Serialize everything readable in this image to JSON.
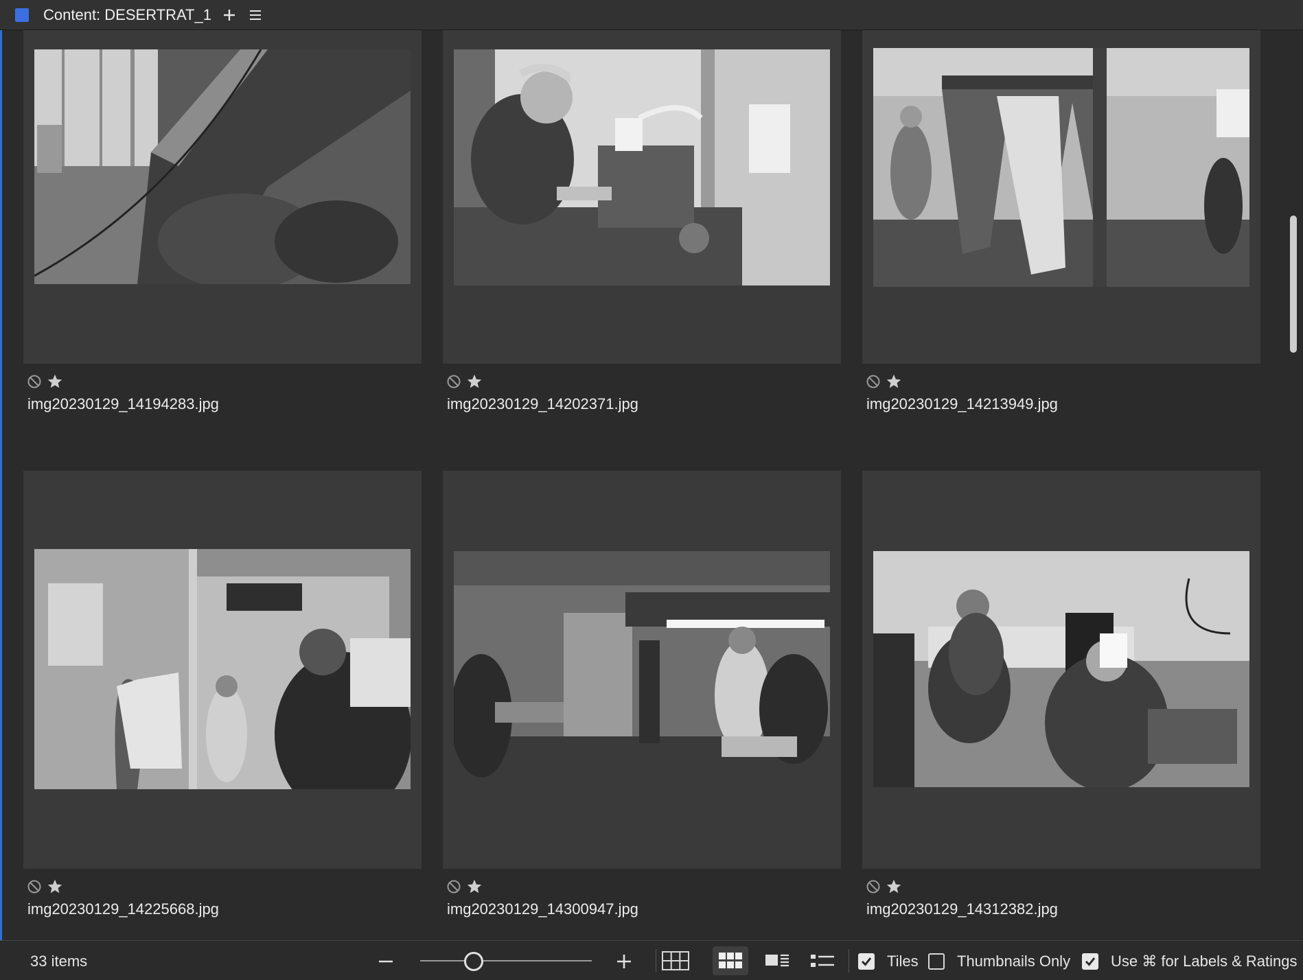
{
  "header": {
    "title": "Content: DESERTRAT_1",
    "add_icon": "plus-icon",
    "menu_icon": "hamburger-menu-icon",
    "swatch_color": "#3b6fe0"
  },
  "tiles": [
    {
      "filename": "img20230129_14194283.jpg"
    },
    {
      "filename": "img20230129_14202371.jpg"
    },
    {
      "filename": "img20230129_14213949.jpg"
    },
    {
      "filename": "img20230129_14225668.jpg"
    },
    {
      "filename": "img20230129_14300947.jpg"
    },
    {
      "filename": "img20230129_14312382.jpg"
    }
  ],
  "footer": {
    "item_count": "33 items",
    "tiles_label": "Tiles",
    "tiles_checked": true,
    "thumbnails_only_label": "Thumbnails Only",
    "thumbnails_only_checked": false,
    "labels_ratings_label": "Use ⌘ for Labels & Ratings",
    "labels_ratings_checked": true
  },
  "colors": {
    "background": "#2b2b2b",
    "tile": "#3a3a3a",
    "accent": "#2f6fd9"
  }
}
